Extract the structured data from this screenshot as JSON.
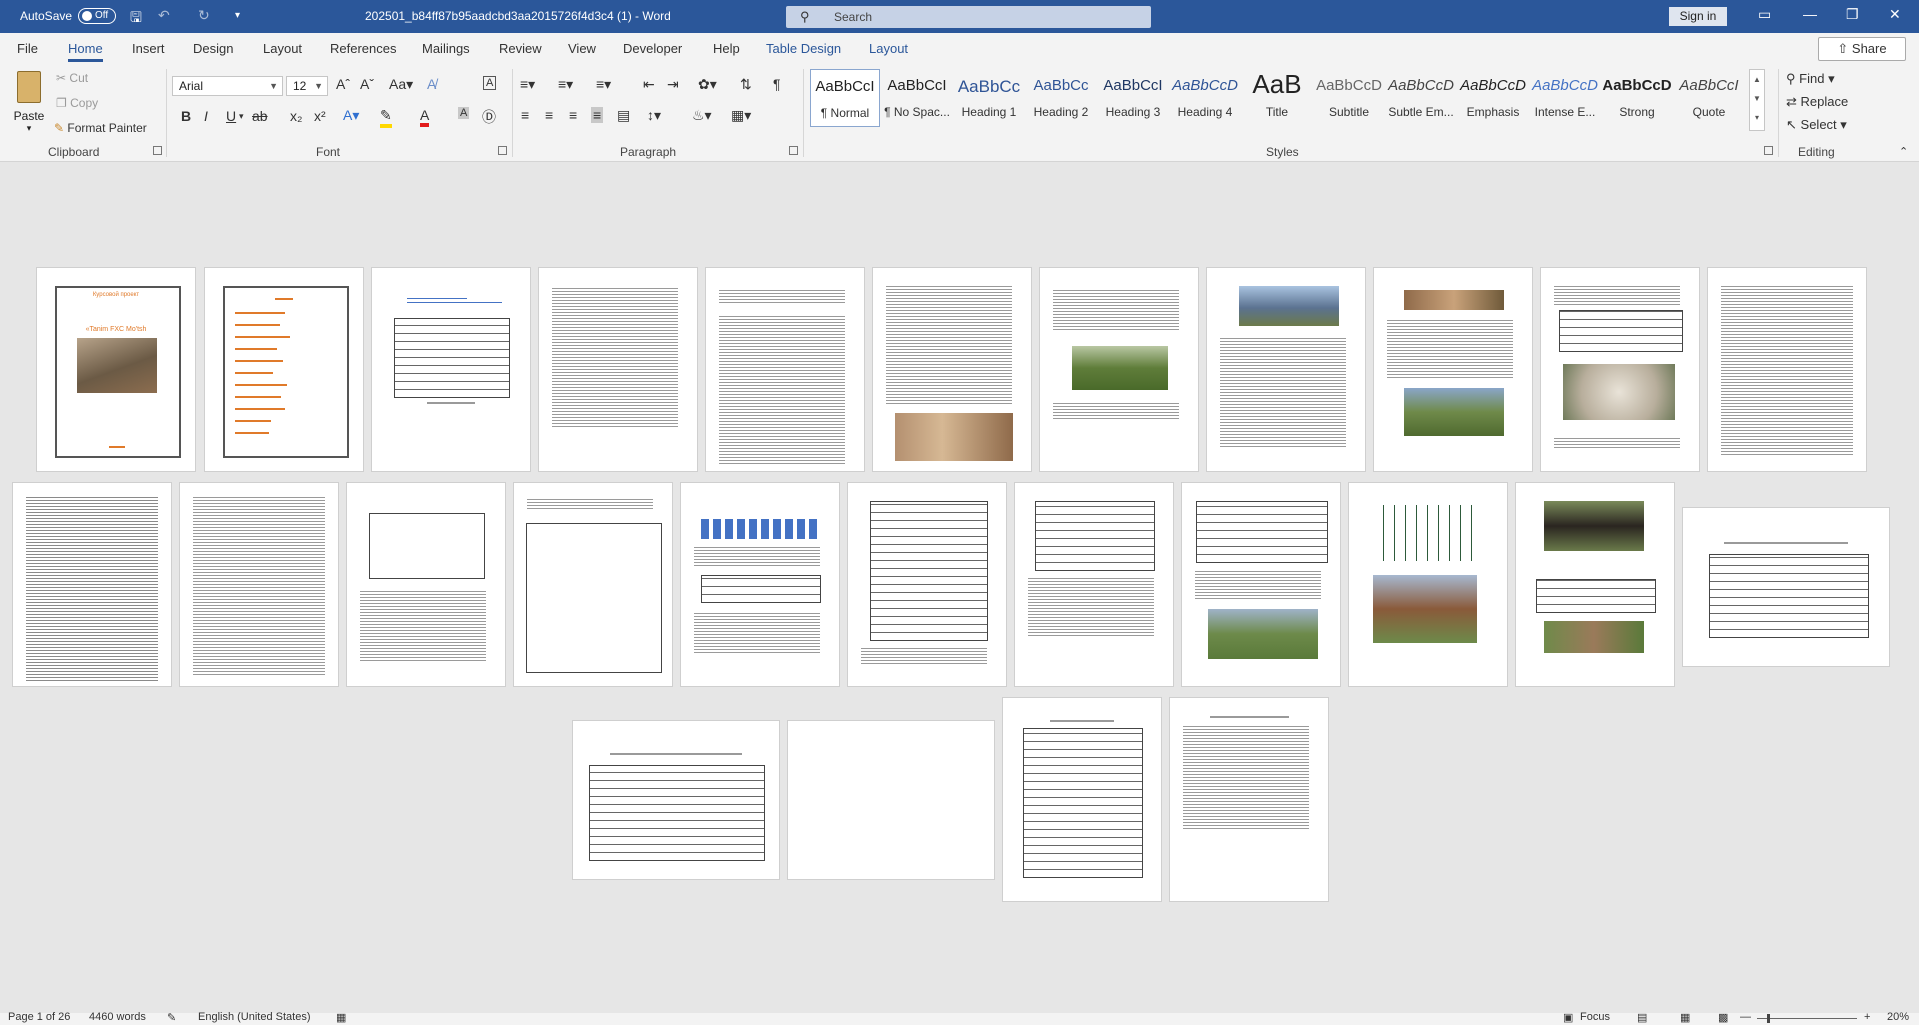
{
  "titlebar": {
    "autosave_label": "AutoSave",
    "autosave_state": "Off",
    "doc_title": "202501_b84ff87b95aadcbd3aa2015726f4d3c4 (1)  -  Word",
    "search_placeholder": "Search",
    "signin_label": "Sign in"
  },
  "tabs": [
    "File",
    "Home",
    "Insert",
    "Design",
    "Layout",
    "References",
    "Mailings",
    "Review",
    "View",
    "Developer",
    "Help",
    "Table Design",
    "Layout"
  ],
  "share_label": "Share",
  "ribbon": {
    "clipboard": {
      "label": "Clipboard",
      "paste": "Paste",
      "cut": "Cut",
      "copy": "Copy",
      "format_painter": "Format Painter"
    },
    "font": {
      "label": "Font",
      "font_name": "Arial",
      "font_size": "12"
    },
    "paragraph": {
      "label": "Paragraph"
    },
    "styles": {
      "label": "Styles",
      "items": [
        {
          "preview": "AaBbCcI",
          "name": "¶ Normal",
          "color": "#222222"
        },
        {
          "preview": "AaBbCcI",
          "name": "¶ No Spac...",
          "color": "#222222"
        },
        {
          "preview": "AaBbCc",
          "name": "Heading 1",
          "color": "#2f5496"
        },
        {
          "preview": "AaBbCc",
          "name": "Heading 2",
          "color": "#2f5496"
        },
        {
          "preview": "AaBbCcI",
          "name": "Heading 3",
          "color": "#1f3763"
        },
        {
          "preview": "AaBbCcD",
          "name": "Heading 4",
          "color": "#2f5496"
        },
        {
          "preview": "AaB",
          "name": "Title",
          "color": "#222222"
        },
        {
          "preview": "AaBbCcD",
          "name": "Subtitle",
          "color": "#666666"
        },
        {
          "preview": "AaBbCcD",
          "name": "Subtle Em...",
          "color": "#444444"
        },
        {
          "preview": "AaBbCcD",
          "name": "Emphasis",
          "color": "#222222"
        },
        {
          "preview": "AaBbCcD",
          "name": "Intense E...",
          "color": "#4472c4"
        },
        {
          "preview": "AaBbCcD",
          "name": "Strong",
          "color": "#222222"
        },
        {
          "preview": "AaBbCcI",
          "name": "Quote",
          "color": "#444444"
        }
      ]
    },
    "editing": {
      "label": "Editing",
      "find": "Find",
      "replace": "Replace",
      "select": "Select"
    }
  },
  "document": {
    "cover_title": "Курсовой проект",
    "cover_subtitle": "«Tanim FXC Mo'tsh"
  },
  "status": {
    "page": "Page 1 of 26",
    "words": "4460 words",
    "language": "English (United States)",
    "focus": "Focus",
    "zoom": "20%"
  },
  "colors": {
    "accent": "#2b579a",
    "cover_orange": "#e07a2a"
  }
}
